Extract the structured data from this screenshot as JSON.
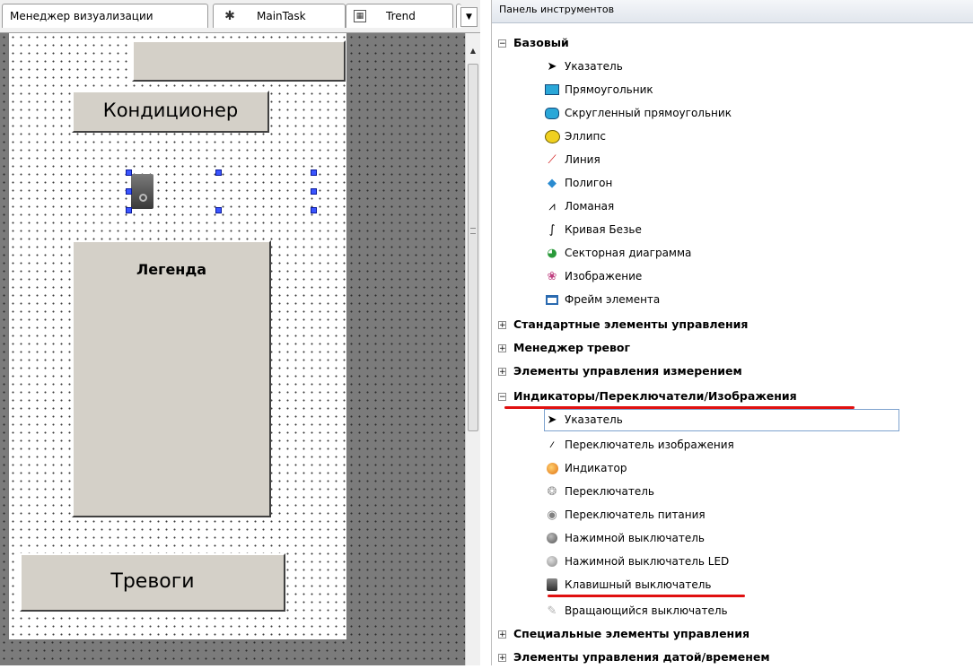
{
  "editor": {
    "tabs": [
      {
        "label": "Менеджер визуализации",
        "icon": "none"
      },
      {
        "label": "MainTask",
        "icon": "task-icon"
      },
      {
        "label": "Trend",
        "icon": "trend-icon"
      }
    ],
    "buttons": {
      "conditioner": "Кондиционер",
      "legend": "Легенда",
      "alarms": "Тревоги"
    }
  },
  "toolbox": {
    "title": "Панель инструментов",
    "basic": {
      "label": "Базовый",
      "expander": "−",
      "items": [
        {
          "label": "Указатель",
          "icon": "pointer-icon"
        },
        {
          "label": "Прямоугольник",
          "icon": "rectangle-icon"
        },
        {
          "label": "Скругленный прямоугольник",
          "icon": "rounded-rectangle-icon"
        },
        {
          "label": "Эллипс",
          "icon": "ellipse-icon"
        },
        {
          "label": "Линия",
          "icon": "line-icon"
        },
        {
          "label": "Полигон",
          "icon": "polygon-icon"
        },
        {
          "label": "Ломаная",
          "icon": "polyline-icon"
        },
        {
          "label": "Кривая Безье",
          "icon": "bezier-icon"
        },
        {
          "label": "Секторная диаграмма",
          "icon": "pie-icon"
        },
        {
          "label": "Изображение",
          "icon": "image-icon"
        },
        {
          "label": "Фрейм элемента",
          "icon": "frame-icon"
        }
      ]
    },
    "collapsed_1": [
      {
        "label": "Стандартные элементы управления",
        "expander": "+"
      },
      {
        "label": "Менеджер тревог",
        "expander": "+"
      },
      {
        "label": "Элементы управления измерением",
        "expander": "+"
      }
    ],
    "indicators": {
      "label": "Индикаторы/Переключатели/Изображения",
      "expander": "−",
      "items": [
        {
          "label": "Указатель",
          "icon": "pointer-icon"
        },
        {
          "label": "Переключатель изображения",
          "icon": "on-off-icon"
        },
        {
          "label": "Индикатор",
          "icon": "lamp-icon"
        },
        {
          "label": "Переключатель",
          "icon": "dial-switch-icon"
        },
        {
          "label": "Переключатель питания",
          "icon": "power-switch-icon"
        },
        {
          "label": "Нажимной выключатель",
          "icon": "push-button-icon"
        },
        {
          "label": "Нажимной выключатель LED",
          "icon": "push-led-icon"
        },
        {
          "label": "Клавишный выключатель",
          "icon": "rocker-switch-icon"
        },
        {
          "label": "Вращающийся выключатель",
          "icon": "rotary-switch-icon"
        }
      ]
    },
    "collapsed_2": [
      {
        "label": "Специальные элементы управления",
        "expander": "+"
      },
      {
        "label": "Элементы управления датой/временем",
        "expander": "+"
      }
    ]
  },
  "colors": {
    "annotation_underline": "#e01010",
    "selection_handle": "#3a55ff",
    "workspace_gray": "#7b7b7b",
    "button_face": "#d4d0c8"
  }
}
